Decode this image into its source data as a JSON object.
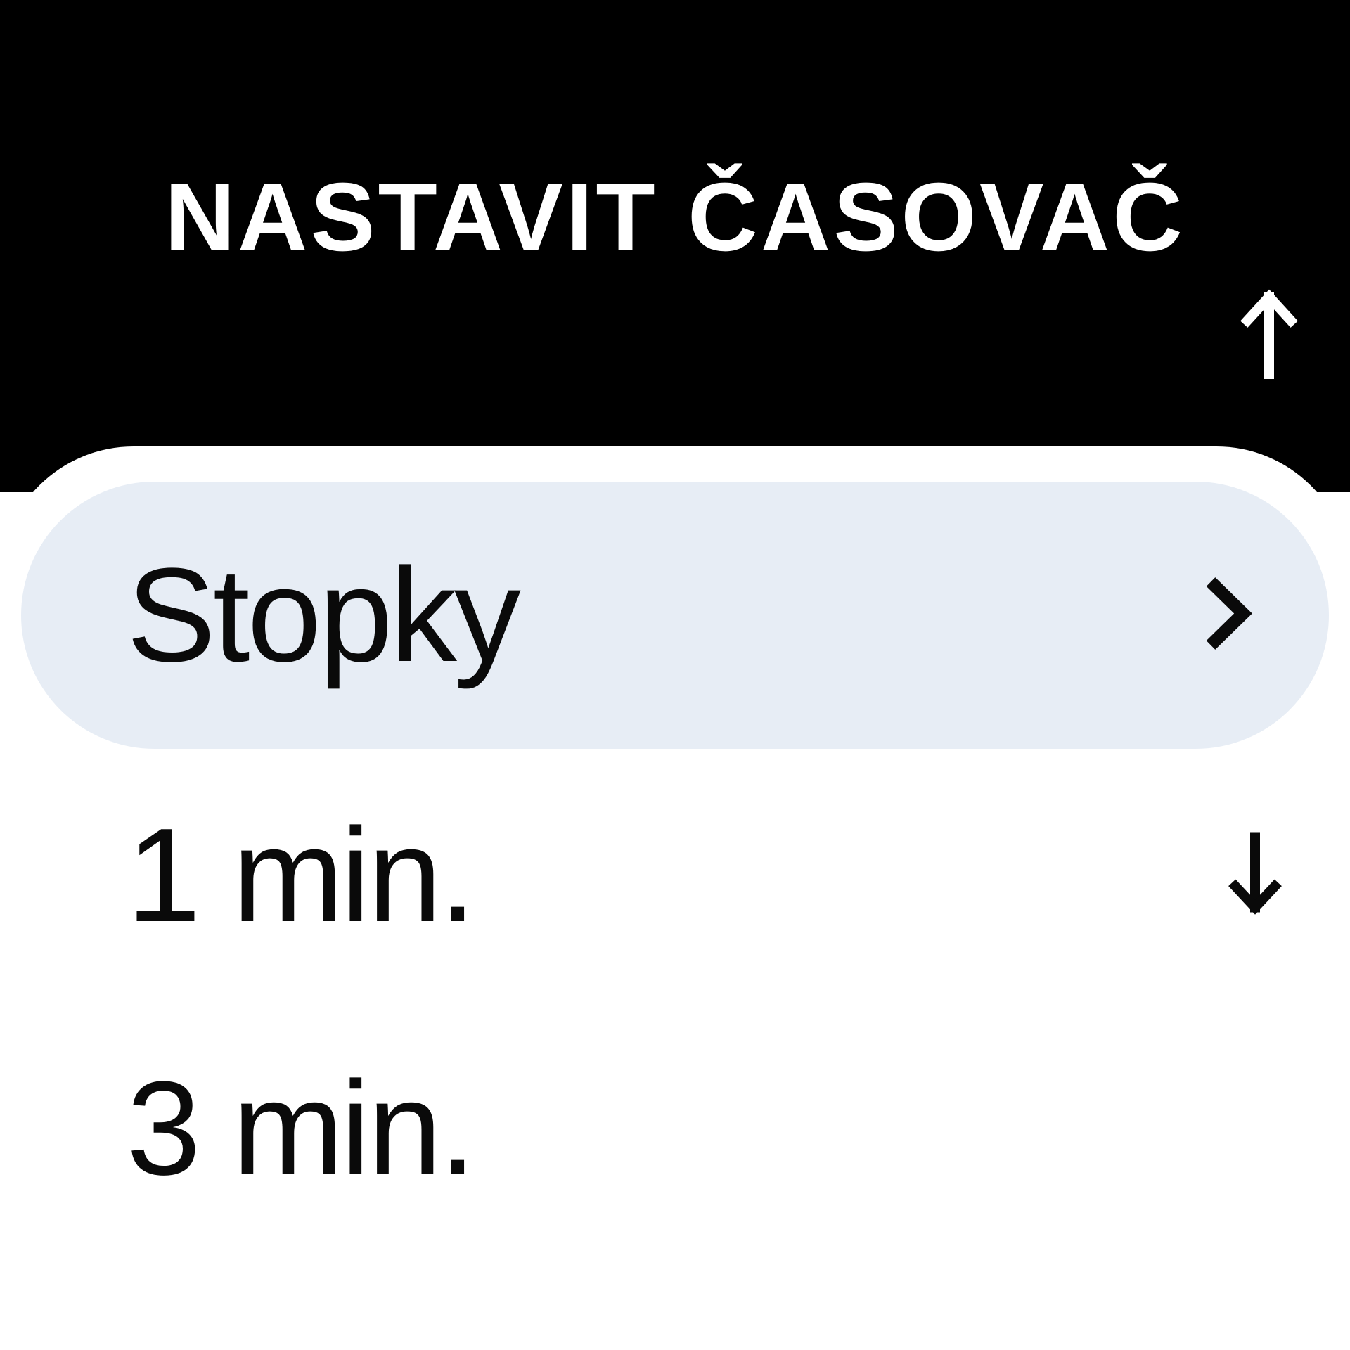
{
  "header": {
    "title": "NASTAVIT ČASOVAČ"
  },
  "list": {
    "items": [
      {
        "label": "Stopky",
        "selected": true
      },
      {
        "label": "1 min."
      },
      {
        "label": "3 min."
      }
    ]
  }
}
